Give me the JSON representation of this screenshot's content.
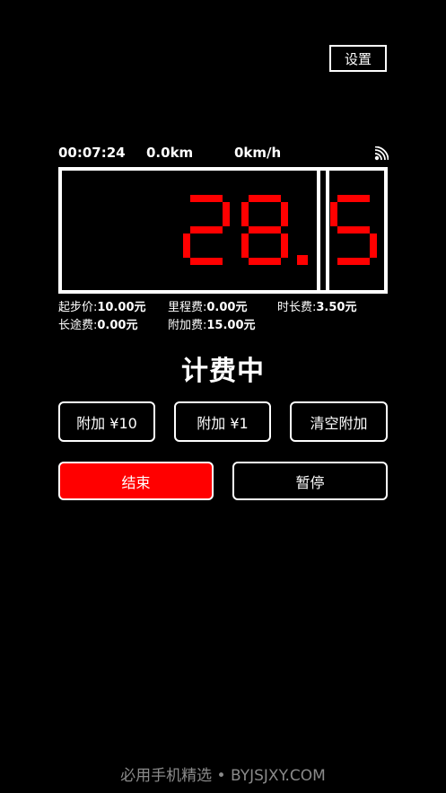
{
  "header": {
    "settings_label": "设置"
  },
  "stats": {
    "elapsed_time": "00:07:24",
    "distance": "0.0km",
    "speed": "0km/h",
    "signal_icon": "signal-icon"
  },
  "meter": {
    "integer_part": "28",
    "decimal_point": ".",
    "decimal_part": "5",
    "digit_color": "#ff0000"
  },
  "fees": {
    "start_label": "起步价:",
    "start_value": "10.00元",
    "mileage_label": "里程费:",
    "mileage_value": "0.00元",
    "duration_label": "时长费:",
    "duration_value": "3.50元",
    "long_distance_label": "长途费:",
    "long_distance_value": "0.00元",
    "extra_label": "附加费:",
    "extra_value": "15.00元"
  },
  "status": {
    "text": "计费中"
  },
  "buttons": {
    "add10": "附加 ¥10",
    "add1": "附加 ¥1",
    "clear_extra": "清空附加",
    "end": "结束",
    "pause": "暂停"
  },
  "colors": {
    "accent": "#ff0000",
    "background": "#000000",
    "foreground": "#ffffff"
  },
  "watermark": {
    "text": "必用手机精选 • BYJSJXY.COM"
  }
}
